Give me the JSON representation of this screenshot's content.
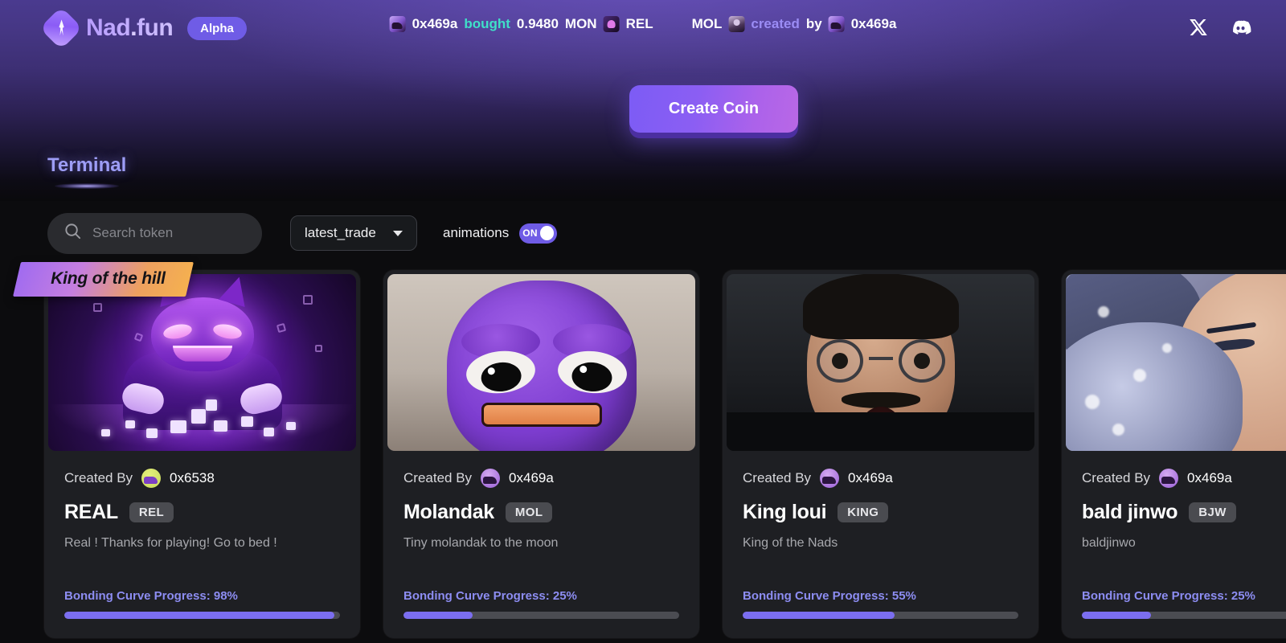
{
  "brand": {
    "name_part1": "Nad",
    "dot": ".",
    "name_part2": "fun",
    "badge": "Alpha",
    "logo_icon": "diamond-sparkle-icon"
  },
  "ticker": {
    "event1": {
      "avatar": "user-avatar-icon",
      "address": "0x469a",
      "action": "bought",
      "amount": "0.9480",
      "currency": "MON",
      "token_icon": "token-icon",
      "token": "REL"
    },
    "event2": {
      "token": "MOL",
      "avatar": "user-avatar-icon",
      "action": "created",
      "by": "by",
      "address": "0x469a"
    }
  },
  "socials": {
    "x_icon": "x-twitter-icon",
    "discord_icon": "discord-icon"
  },
  "hero": {
    "create_button": "Create Coin"
  },
  "tabs": {
    "terminal": "Terminal"
  },
  "search": {
    "placeholder": "Search token",
    "value": "",
    "icon": "search-icon"
  },
  "sort": {
    "selected": "latest_trade",
    "icon": "chevron-down-icon"
  },
  "animations": {
    "label": "animations",
    "state": "ON"
  },
  "badges": {
    "king_of_the_hill": "King of the hill"
  },
  "card_labels": {
    "created_by": "Created By",
    "progress_prefix": "Bonding Curve Progress: "
  },
  "colors": {
    "accent_purple": "#7b6ef0",
    "link_purple": "#8d8df2",
    "brand_purple": "#6f5ce6",
    "ticker_buy_green": "#3fe0c8",
    "ticker_created_purple": "#9b8cf5",
    "card_bg": "#1e1f23",
    "page_bg": "#0c0c0e"
  },
  "cards": [
    {
      "creator": "0x6538",
      "avatar_style": "green",
      "name": "REAL",
      "symbol": "REL",
      "description": "Real ! Thanks for playing! Go to bed !",
      "progress_text": "Bonding Curve Progress: 98%",
      "progress_pct": 98,
      "king_of_the_hill": true,
      "art": "purple-goblin-with-cubes"
    },
    {
      "creator": "0x469a",
      "avatar_style": "purple",
      "name": "Molandak",
      "symbol": "MOL",
      "description": "Tiny molandak to the moon",
      "progress_text": "Bonding Curve Progress: 25%",
      "progress_pct": 25,
      "king_of_the_hill": false,
      "art": "purple-plush-mascot"
    },
    {
      "creator": "0x469a",
      "avatar_style": "purple",
      "name": "King loui",
      "symbol": "KING",
      "description": "King of the Nads",
      "progress_text": "Bonding Curve Progress: 55%",
      "progress_pct": 55,
      "king_of_the_hill": false,
      "art": "shocked-man-photo"
    },
    {
      "creator": "0x469a",
      "avatar_style": "purple",
      "name": "bald jinwo",
      "symbol": "BJW",
      "description": "baldjinwo",
      "progress_text": "Bonding Curve Progress: 25%",
      "progress_pct": 25,
      "king_of_the_hill": false,
      "art": "anime-character-shushing"
    }
  ]
}
